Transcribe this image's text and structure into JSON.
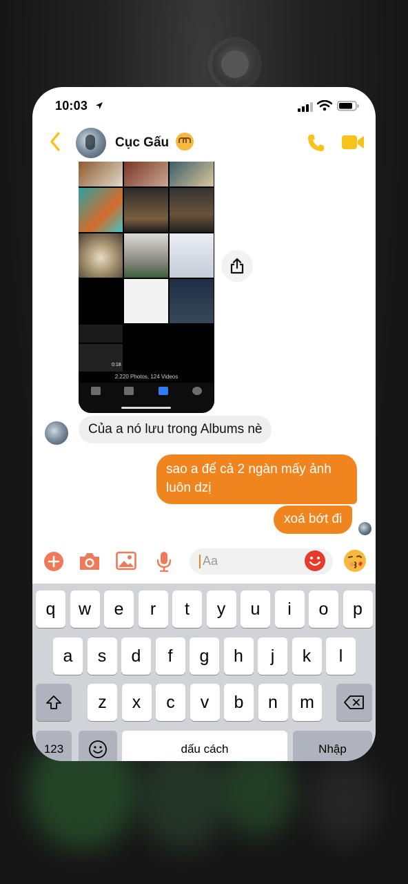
{
  "status_bar": {
    "time": "10:03"
  },
  "header": {
    "contact_name": "Cục Gấu"
  },
  "shared_photo": {
    "photo_count_text": "2.220 Photos, 124 Videos",
    "video_duration": "0:18"
  },
  "messages": [
    {
      "direction": "incoming",
      "text": "Của a nó lưu trong Albums nè"
    },
    {
      "direction": "outgoing",
      "text": "sao a để cả 2 ngàn mấy ảnh luôn dzị"
    },
    {
      "direction": "outgoing",
      "text": "xoá bớt đi"
    }
  ],
  "composer": {
    "placeholder": "Aa"
  },
  "keyboard": {
    "row1": [
      "q",
      "w",
      "e",
      "r",
      "t",
      "y",
      "u",
      "i",
      "o",
      "p"
    ],
    "row2": [
      "a",
      "s",
      "d",
      "f",
      "g",
      "h",
      "j",
      "k",
      "l"
    ],
    "row3": [
      "z",
      "x",
      "c",
      "v",
      "b",
      "n",
      "m"
    ],
    "numbers_key": "123",
    "space_key": "dấu cách",
    "return_key": "Nhập"
  },
  "colors": {
    "accent": "#F0841E",
    "nav_icons": "#F7C21A",
    "keyboard_bg": "#D1D3D9"
  },
  "icons": [
    "back-chevron-icon",
    "phone-icon",
    "video-call-icon",
    "share-icon",
    "plus-icon",
    "camera-icon",
    "image-icon",
    "microphone-icon",
    "emoji-icon",
    "kiss-emoji-icon",
    "shift-icon",
    "backspace-icon",
    "keyboard-emoji-icon"
  ]
}
